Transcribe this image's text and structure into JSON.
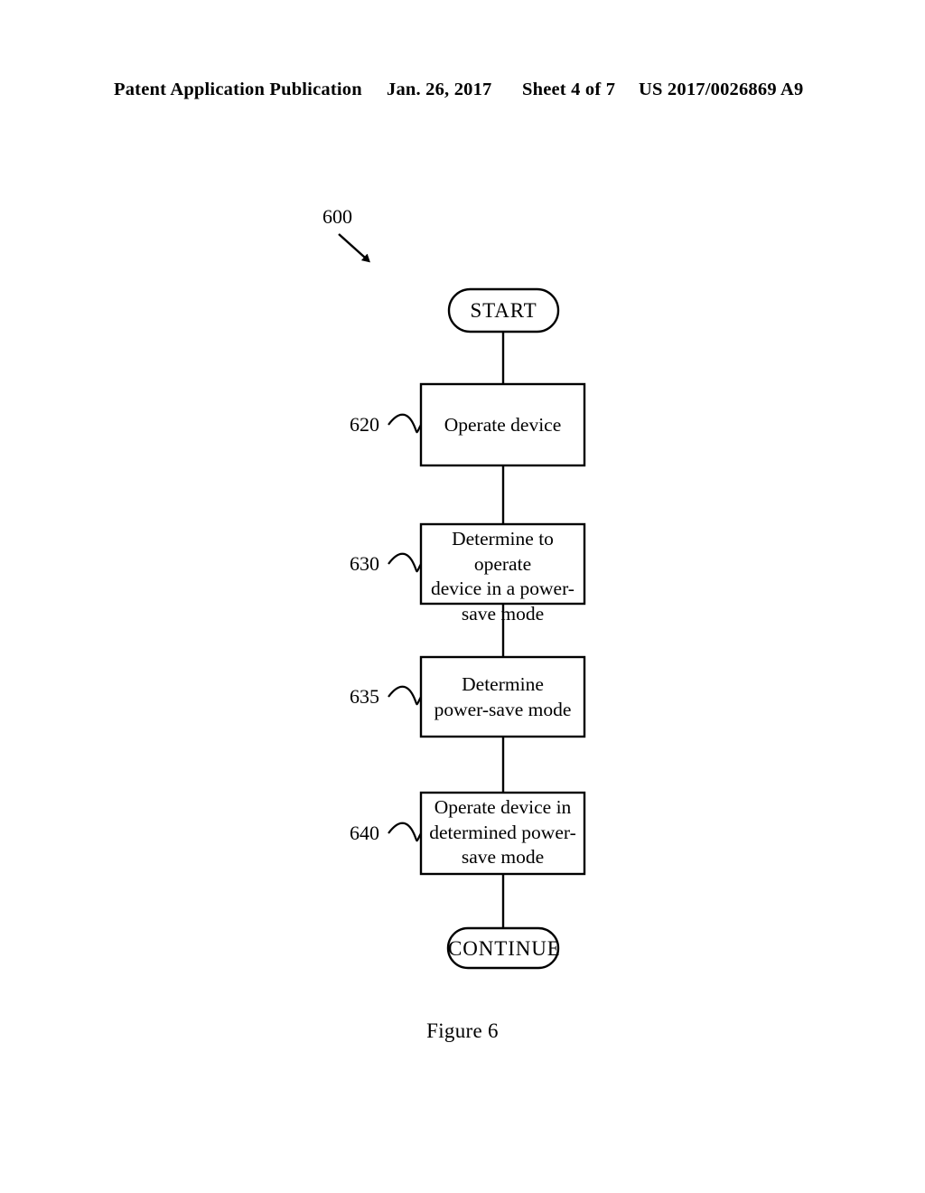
{
  "header": {
    "publication": "Patent Application Publication",
    "date": "Jan. 26, 2017",
    "sheet": "Sheet 4 of 7",
    "pub_number": "US 2017/0026869 A9"
  },
  "figure": {
    "caption": "Figure 6",
    "diagram_ref": "600",
    "start_label": "START",
    "end_label": "CONTINUE",
    "steps": [
      {
        "ref": "620",
        "text": "Operate device"
      },
      {
        "ref": "630",
        "text": "Determine to operate\ndevice in a power-\nsave mode"
      },
      {
        "ref": "635",
        "text": "Determine\npower-save mode"
      },
      {
        "ref": "640",
        "text": "Operate device in\ndetermined power-\nsave mode"
      }
    ]
  },
  "colors": {
    "ink": "#000000",
    "paper": "#ffffff"
  }
}
